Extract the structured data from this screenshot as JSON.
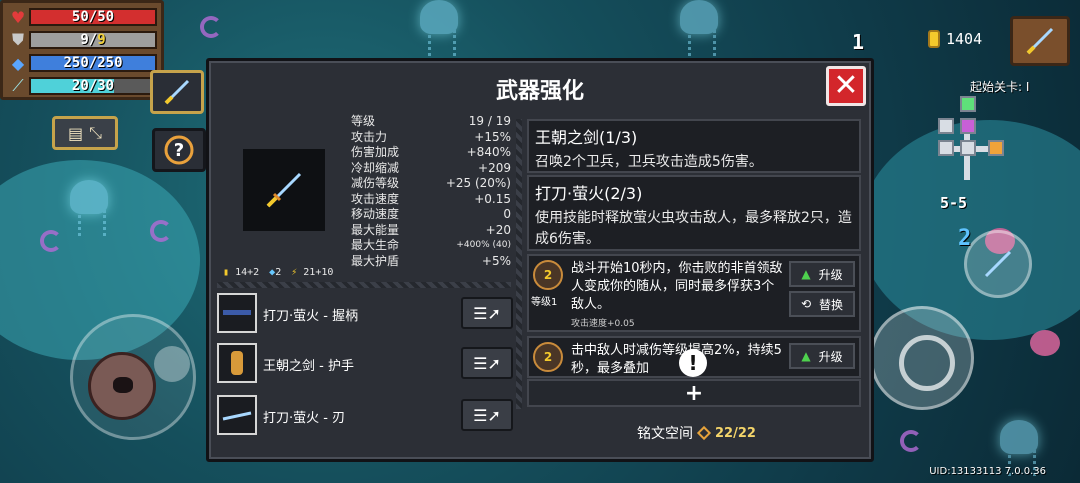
{
  "hud": {
    "hp": {
      "value": 50,
      "max": 50,
      "color": "#d32f2f"
    },
    "armor": {
      "value": 9,
      "max": 9,
      "color": "#9e9e9e"
    },
    "energy": {
      "value": 250,
      "max": 250,
      "color": "#3f7fdc"
    },
    "stamina": {
      "value": 20,
      "max": 30,
      "color": "#4fd1d9"
    }
  },
  "top_right": {
    "level_indicator": "1",
    "gold": "1404",
    "minimap_label": "起始关卡: I",
    "stage": "5-5"
  },
  "skill_count": "2",
  "uid": "UID:13133113 7.0.0.36",
  "dialog": {
    "title": "武器强化",
    "close_label": "✕",
    "meta": {
      "ammo": "14+2",
      "gems": "2",
      "boost": "21+10"
    },
    "stats": [
      {
        "label": "等级",
        "value": "19 / 19"
      },
      {
        "label": "攻击力",
        "value": "+15%"
      },
      {
        "label": "伤害加成",
        "value": "+840%"
      },
      {
        "label": "冷却缩减",
        "value": "+209"
      },
      {
        "label": "减伤等级",
        "value": "+25 (20%)"
      },
      {
        "label": "攻击速度",
        "value": "+0.15"
      },
      {
        "label": "移动速度",
        "value": "0"
      },
      {
        "label": "最大能量",
        "value": "+20"
      },
      {
        "label": "最大生命",
        "value": "+400% (40)"
      },
      {
        "label": "最大护盾",
        "value": "+5%"
      }
    ],
    "parts": [
      {
        "name": "打刀·萤火 - 握柄"
      },
      {
        "name": "王朝之剑 - 护手"
      },
      {
        "name": "打刀·萤火 - 刃"
      }
    ],
    "effects": [
      {
        "title": "王朝之剑(1/3)",
        "desc": "召唤2个卫兵，卫兵攻击造成5伤害。"
      },
      {
        "title": "打刀·萤火(2/3)",
        "desc": "使用技能时释放萤火虫攻击敌人，最多释放2只，造成6伤害。"
      }
    ],
    "inscriptions": [
      {
        "level": "等级1",
        "icon_badge": "2",
        "text": "战斗开始10秒内，你击败的非首领敌人变成你的随从，同时最多俘获3个敌人。",
        "sub": "攻击速度+0.05",
        "upgrade_label": "升级",
        "replace_label": "替换"
      },
      {
        "icon_badge": "2",
        "text": "击中敌人时减伤等级提高2%，持续5秒，最多叠加",
        "upgrade_label": "升级"
      }
    ],
    "add_label": "+",
    "rune_space_label": "铭文空间",
    "rune_space_value": "22/22"
  }
}
